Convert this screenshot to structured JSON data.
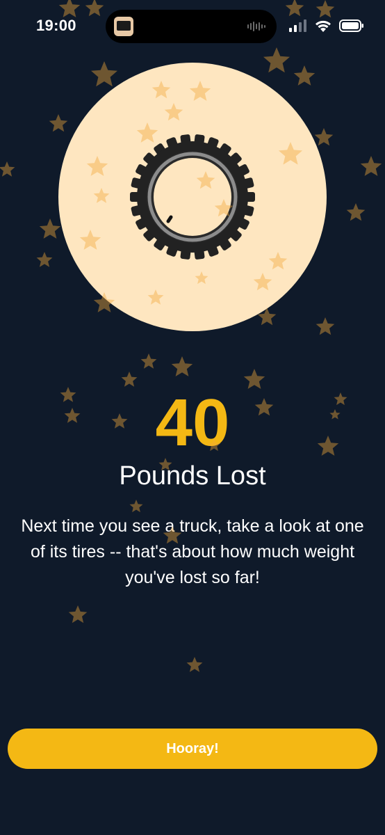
{
  "status_bar": {
    "time": "19:00",
    "signal_icon": "cellular-signal-icon",
    "wifi_icon": "wifi-icon",
    "battery_icon": "battery-icon",
    "island_icon": "now-playing-thumbnail-icon",
    "island_wave_icon": "audio-waveform-icon"
  },
  "illustration": {
    "icon": "tire-icon",
    "circle_color": "#fee6c0",
    "tire_color": "#222222"
  },
  "result": {
    "value": "40",
    "label": "Pounds Lost",
    "message": "Next time you see a truck, take a look at one of its tires -- that's about how much weight you've lost so far!"
  },
  "actions": {
    "primary_label": "Hooray!"
  },
  "colors": {
    "background": "#0f1a2a",
    "accent": "#f4b814",
    "star": "#f2a93b",
    "text": "#ffffff"
  },
  "decorations": {
    "star_icon": "star-icon"
  }
}
